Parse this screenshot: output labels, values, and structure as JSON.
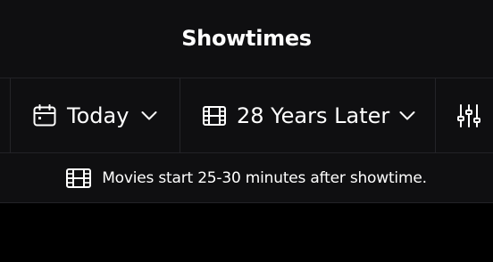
{
  "header": {
    "title": "Showtimes"
  },
  "filters": {
    "date": {
      "label": "Today",
      "icon": "calendar-icon"
    },
    "movie": {
      "label": "28 Years Later",
      "icon": "film-icon"
    },
    "settings": {
      "icon": "sliders-icon"
    }
  },
  "notice": {
    "text": "Movies start 25-30 minutes after showtime.",
    "icon": "film-icon"
  },
  "colors": {
    "background": "#000000",
    "bar_background": "#0f0f11",
    "divider": "#242428",
    "text": "#ffffff"
  }
}
